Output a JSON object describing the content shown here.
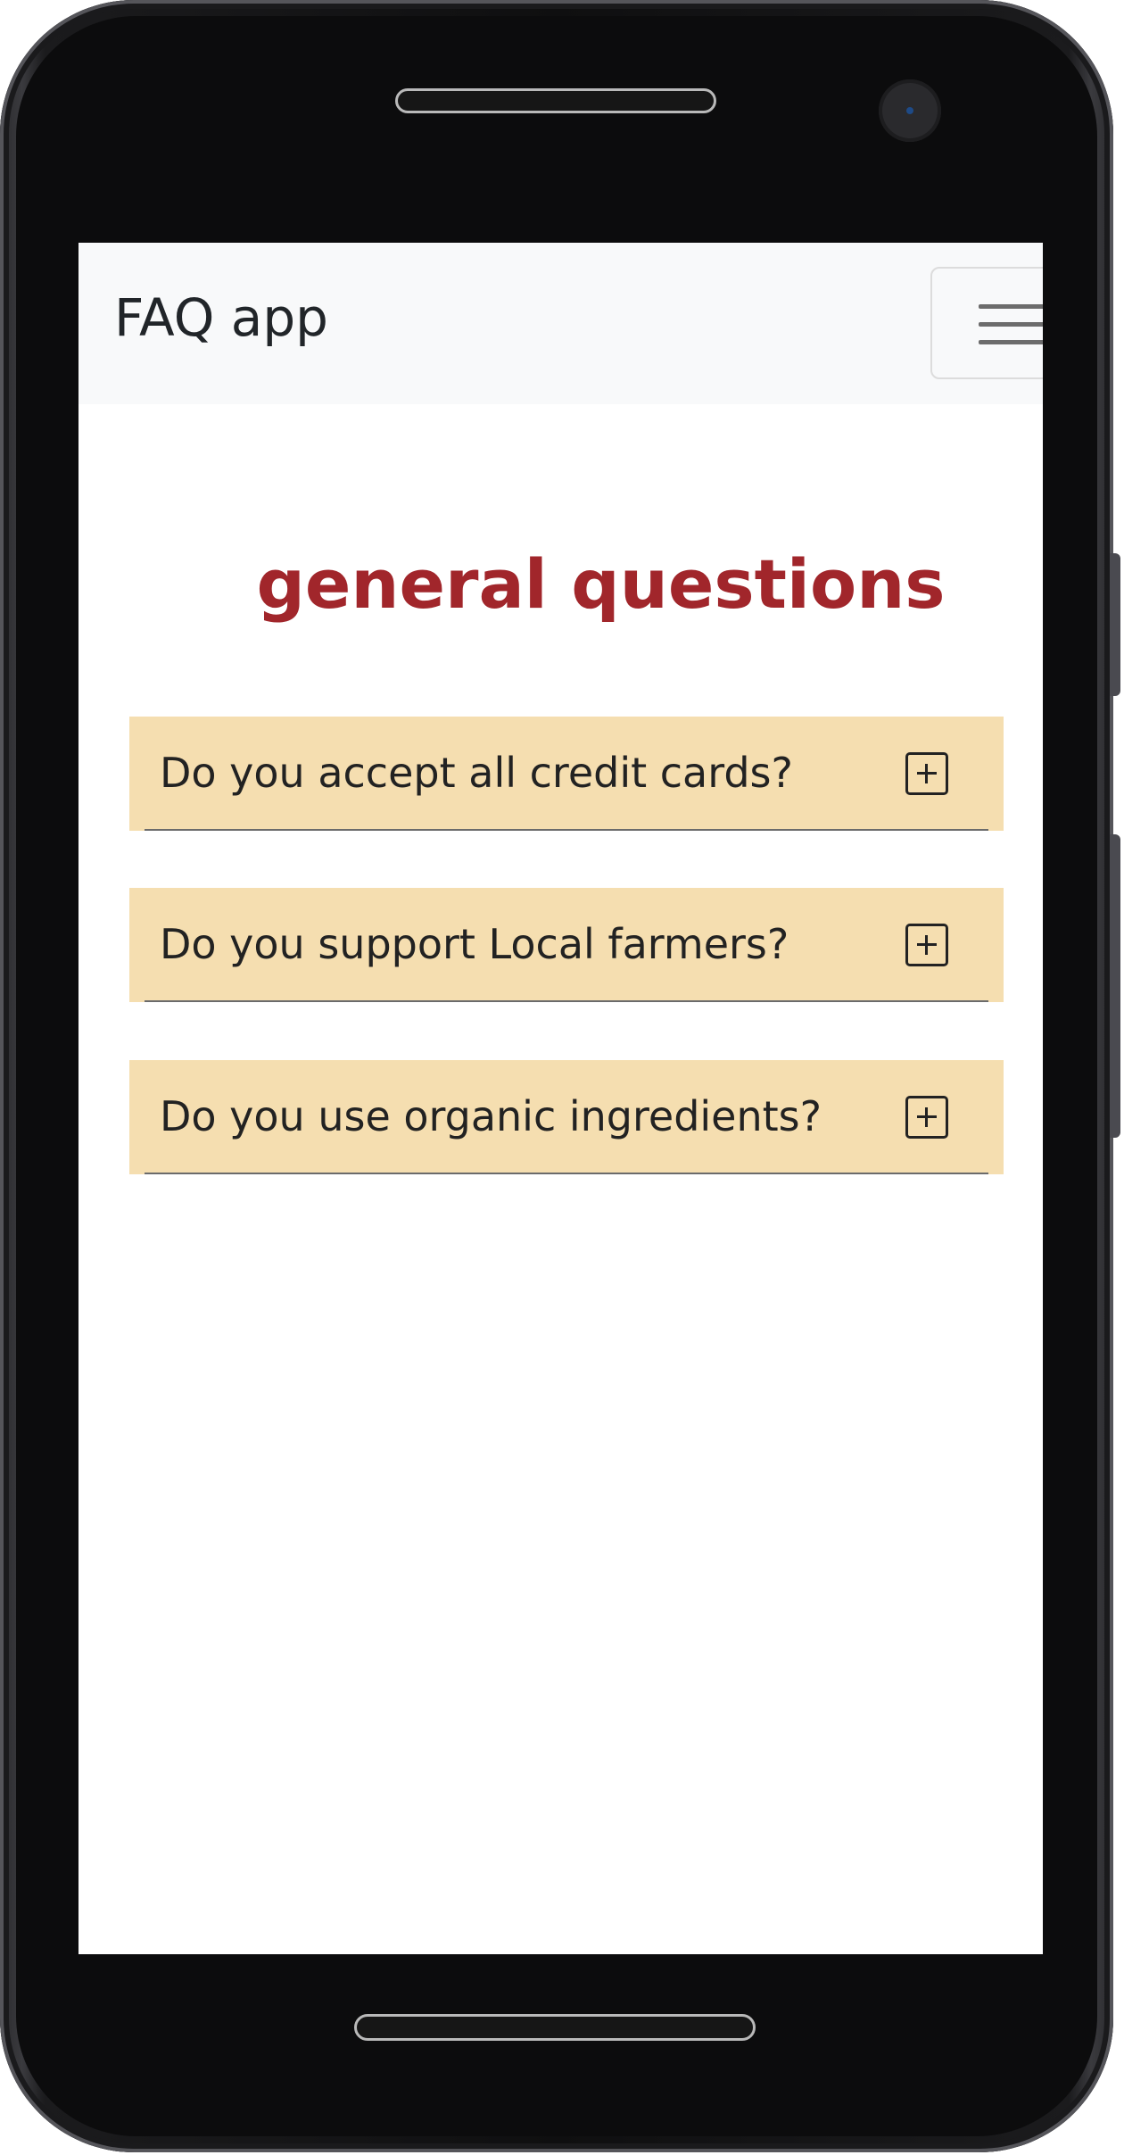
{
  "navbar": {
    "brand": "FAQ app",
    "menu_icon": "hamburger-menu-icon"
  },
  "section": {
    "title": "general questions"
  },
  "faq": [
    {
      "question": "Do you accept all credit cards?",
      "icon": "plus-square-icon"
    },
    {
      "question": "Do you support Local farmers?",
      "icon": "plus-square-icon"
    },
    {
      "question": "Do you use organic ingredients?",
      "icon": "plus-square-icon"
    }
  ],
  "colors": {
    "title": "#a1262b",
    "faq_background": "#f5deb0",
    "navbar_background": "#f8f9fa"
  }
}
